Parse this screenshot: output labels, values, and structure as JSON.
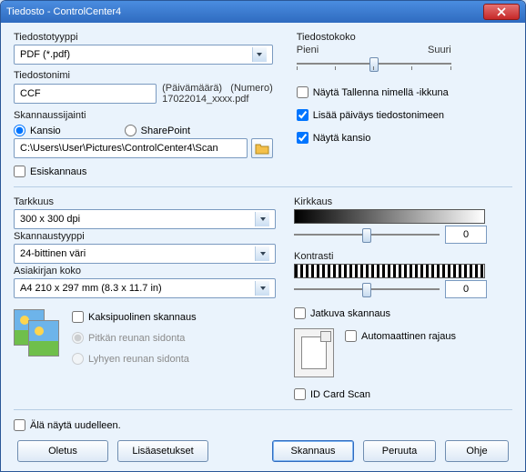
{
  "window": {
    "title": "Tiedosto - ControlCenter4"
  },
  "filetype": {
    "label": "Tiedostotyyppi",
    "value": "PDF (*.pdf)"
  },
  "filesize": {
    "label": "Tiedostokoko",
    "min": "Pieni",
    "max": "Suuri"
  },
  "filename": {
    "label": "Tiedostonimi",
    "value": "CCF",
    "date_hdr": "(Päivämäärä)",
    "num_hdr": "(Numero)",
    "pattern": "17022014_xxxx.pdf"
  },
  "saveas": {
    "label": "Näytä Tallenna nimellä -ikkuna",
    "checked": false
  },
  "adddate": {
    "label": "Lisää päiväys tiedostonimeen",
    "checked": true
  },
  "showfolder": {
    "label": "Näytä kansio",
    "checked": true
  },
  "scanloc": {
    "label": "Skannaussijainti",
    "folder": "Kansio",
    "sharepoint": "SharePoint",
    "path": "C:\\Users\\User\\Pictures\\ControlCenter4\\Scan"
  },
  "prescan": {
    "label": "Esiskannaus",
    "checked": false
  },
  "resolution": {
    "label": "Tarkkuus",
    "value": "300 x 300 dpi"
  },
  "scantype": {
    "label": "Skannaustyyppi",
    "value": "24-bittinen väri"
  },
  "docsize": {
    "label": "Asiakirjan koko",
    "value": "A4 210 x 297 mm (8.3 x 11.7 in)"
  },
  "brightness": {
    "label": "Kirkkaus",
    "value": "0"
  },
  "contrast": {
    "label": "Kontrasti",
    "value": "0"
  },
  "continuous": {
    "label": "Jatkuva skannaus",
    "checked": false
  },
  "duplex": {
    "label": "Kaksipuolinen skannaus",
    "long": "Pitkän reunan sidonta",
    "short": "Lyhyen reunan sidonta"
  },
  "autocrop": {
    "label": "Automaattinen rajaus",
    "checked": false
  },
  "idcard": {
    "label": "ID Card Scan",
    "checked": false
  },
  "dontshow": {
    "label": "Älä näytä uudelleen.",
    "checked": false
  },
  "buttons": {
    "default": "Oletus",
    "advanced": "Lisäasetukset",
    "scan": "Skannaus",
    "cancel": "Peruuta",
    "help": "Ohje"
  }
}
